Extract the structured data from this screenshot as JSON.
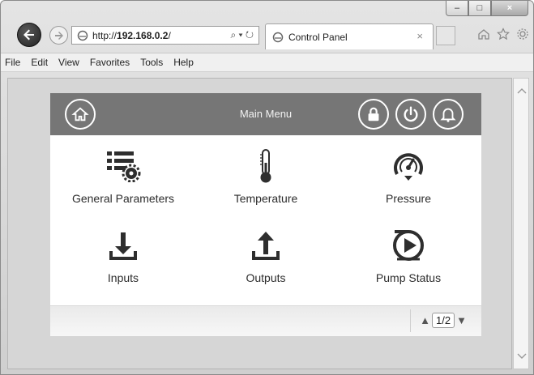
{
  "browser": {
    "url_prefix": "http://",
    "url_host": "192.168.0.2",
    "url_suffix": "/",
    "address_tools": "⌕ ▾ ↻",
    "tab_title": "Control Panel",
    "tab_close": "×",
    "caption": {
      "minimize": "–",
      "maximize": "□",
      "close": "×"
    },
    "icons": [
      "home-icon",
      "star-icon",
      "gear-icon"
    ]
  },
  "menubar": {
    "items": [
      "File",
      "Edit",
      "View",
      "Favorites",
      "Tools",
      "Help"
    ]
  },
  "panel": {
    "title": "Main Menu",
    "header_icons": [
      "home-icon",
      "lock-icon",
      "power-icon",
      "bell-icon"
    ],
    "tiles": [
      {
        "label": "General Parameters",
        "icon": "parameters-gear-icon"
      },
      {
        "label": "Temperature",
        "icon": "thermometer-icon"
      },
      {
        "label": "Pressure",
        "icon": "pressure-gauge-icon"
      },
      {
        "label": "Inputs",
        "icon": "download-arrow-icon"
      },
      {
        "label": "Outputs",
        "icon": "upload-arrow-icon"
      },
      {
        "label": "Pump Status",
        "icon": "pump-play-icon"
      }
    ],
    "pager": {
      "page": "1/2",
      "up": "▲",
      "down": "▼"
    }
  },
  "colors": {
    "header_bg": "#767676",
    "panel_bg": "#ffffff",
    "content_bg": "#d6d6d6"
  }
}
